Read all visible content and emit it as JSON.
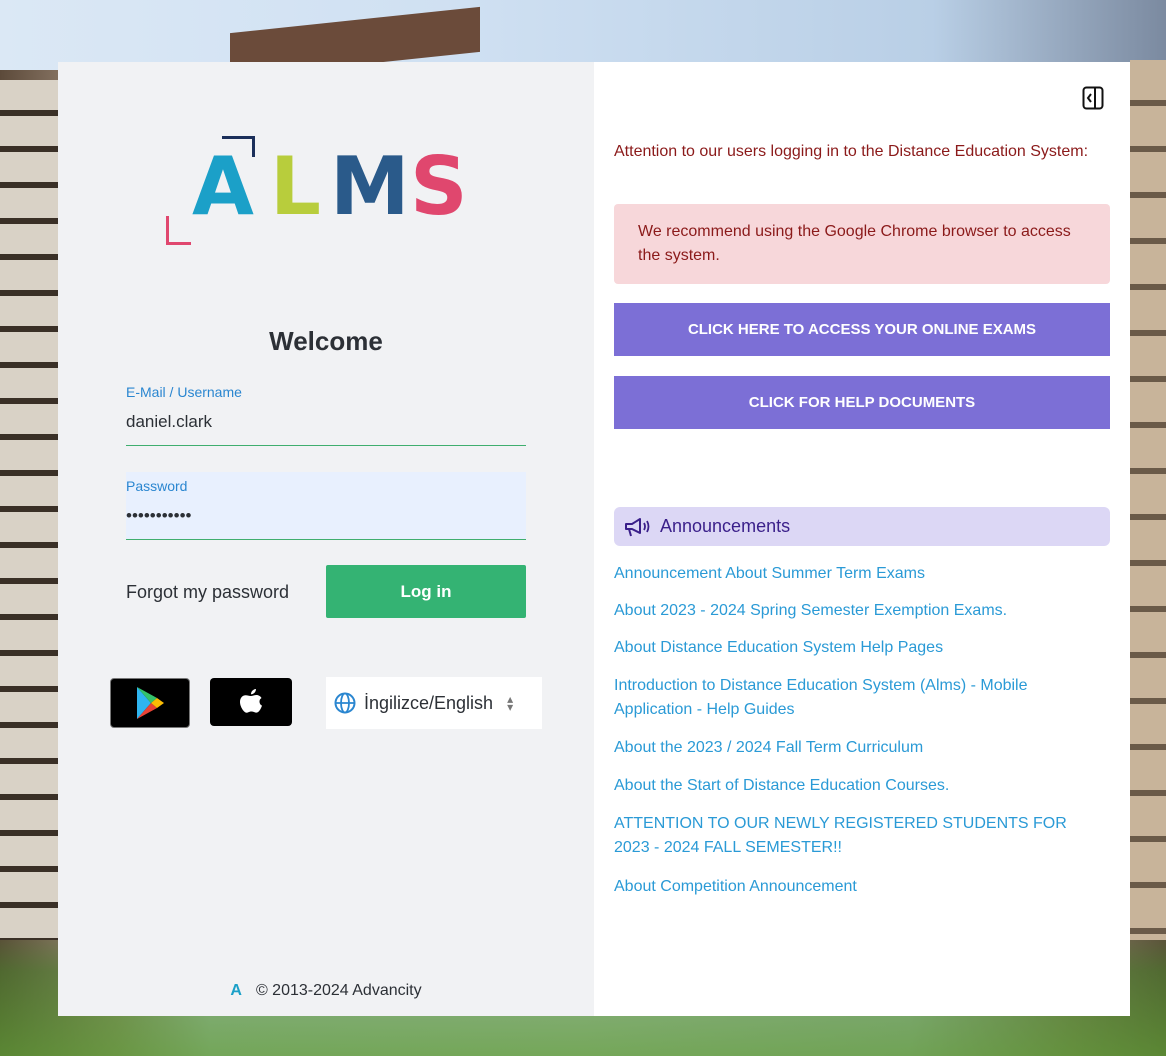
{
  "logo": {
    "letters": [
      "A",
      "L",
      "M",
      "S"
    ]
  },
  "login": {
    "welcome": "Welcome",
    "username_label": "E-Mail / Username",
    "username_value": "daniel.clark",
    "password_label": "Password",
    "password_value": "•••••••••••",
    "forgot_label": "Forgot my password",
    "login_label": "Log in"
  },
  "language": {
    "selected": "İngilizce/English"
  },
  "footer": {
    "logo_letter": "A",
    "copyright": "© 2013-2024 Advancity"
  },
  "notice": {
    "attention": "Attention to our users logging in to the Distance Education System:",
    "recommendation": "We recommend using the Google Chrome browser to access the system."
  },
  "buttons": {
    "exams": "CLICK HERE TO ACCESS YOUR ONLINE EXAMS",
    "help": "CLICK FOR HELP DOCUMENTS"
  },
  "announcements": {
    "title": "Announcements",
    "items": [
      "Announcement About Summer Term Exams",
      "About 2023 - 2024 Spring Semester Exemption Exams.",
      "About Distance Education System Help Pages",
      "Introduction to Distance Education System (Alms) - Mobile Application - Help Guides",
      "About the 2023 / 2024 Fall Term Curriculum",
      "About the Start of Distance Education Courses.",
      "ATTENTION TO OUR NEWLY REGISTERED STUDENTS FOR 2023 - 2024 FALL SEMESTER!!",
      "About Competition Announcement"
    ]
  },
  "icons": {
    "collapse": "panel-collapse-icon",
    "globe": "globe-icon",
    "megaphone": "megaphone-icon",
    "google_play": "google-play-icon",
    "apple": "apple-icon"
  },
  "colors": {
    "login_green": "#34b373",
    "purple_button": "#7c6fd6",
    "announcement_link": "#2a9ad6",
    "alert_bg": "#f7d7da",
    "alert_text": "#8b1a1a"
  }
}
